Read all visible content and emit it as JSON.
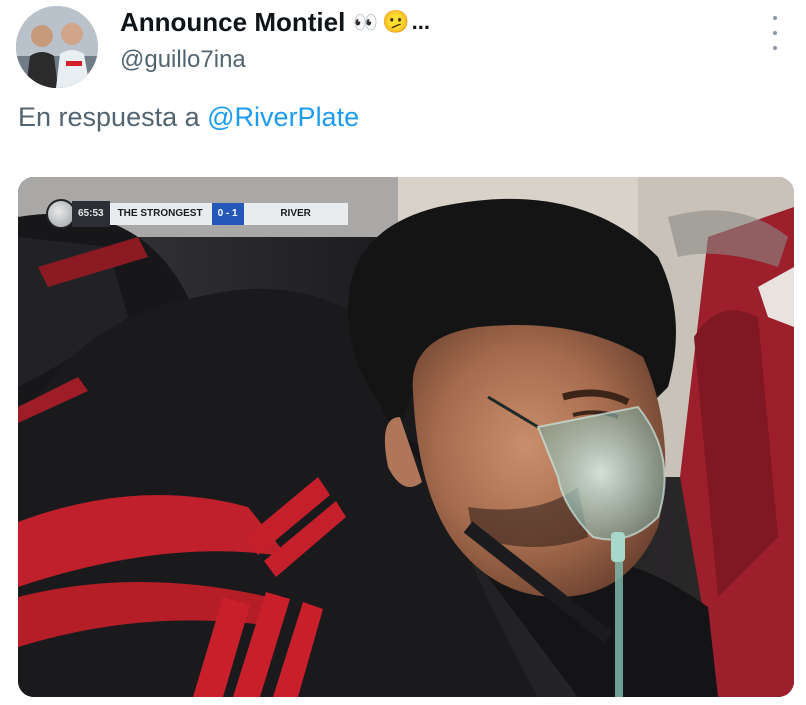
{
  "tweet": {
    "display_name": "Announce Montiel",
    "name_emojis": {
      "eyes": "👀",
      "face": "🫤"
    },
    "name_suffix": "...",
    "handle": "@guillo7ina",
    "reply_prefix": "En respuesta a",
    "reply_target": "@RiverPlate",
    "avatar_icon": "user-avatar",
    "menu_icon": "more-vertical-icon"
  },
  "media": {
    "scorebug": {
      "time": "65:53",
      "home_team": "THE STRONGEST",
      "score": "0 - 1",
      "away_team": "RIVER"
    }
  },
  "colors": {
    "link": "#1d9bf0",
    "secondary_text": "#536471",
    "primary_text": "#0f1419"
  }
}
